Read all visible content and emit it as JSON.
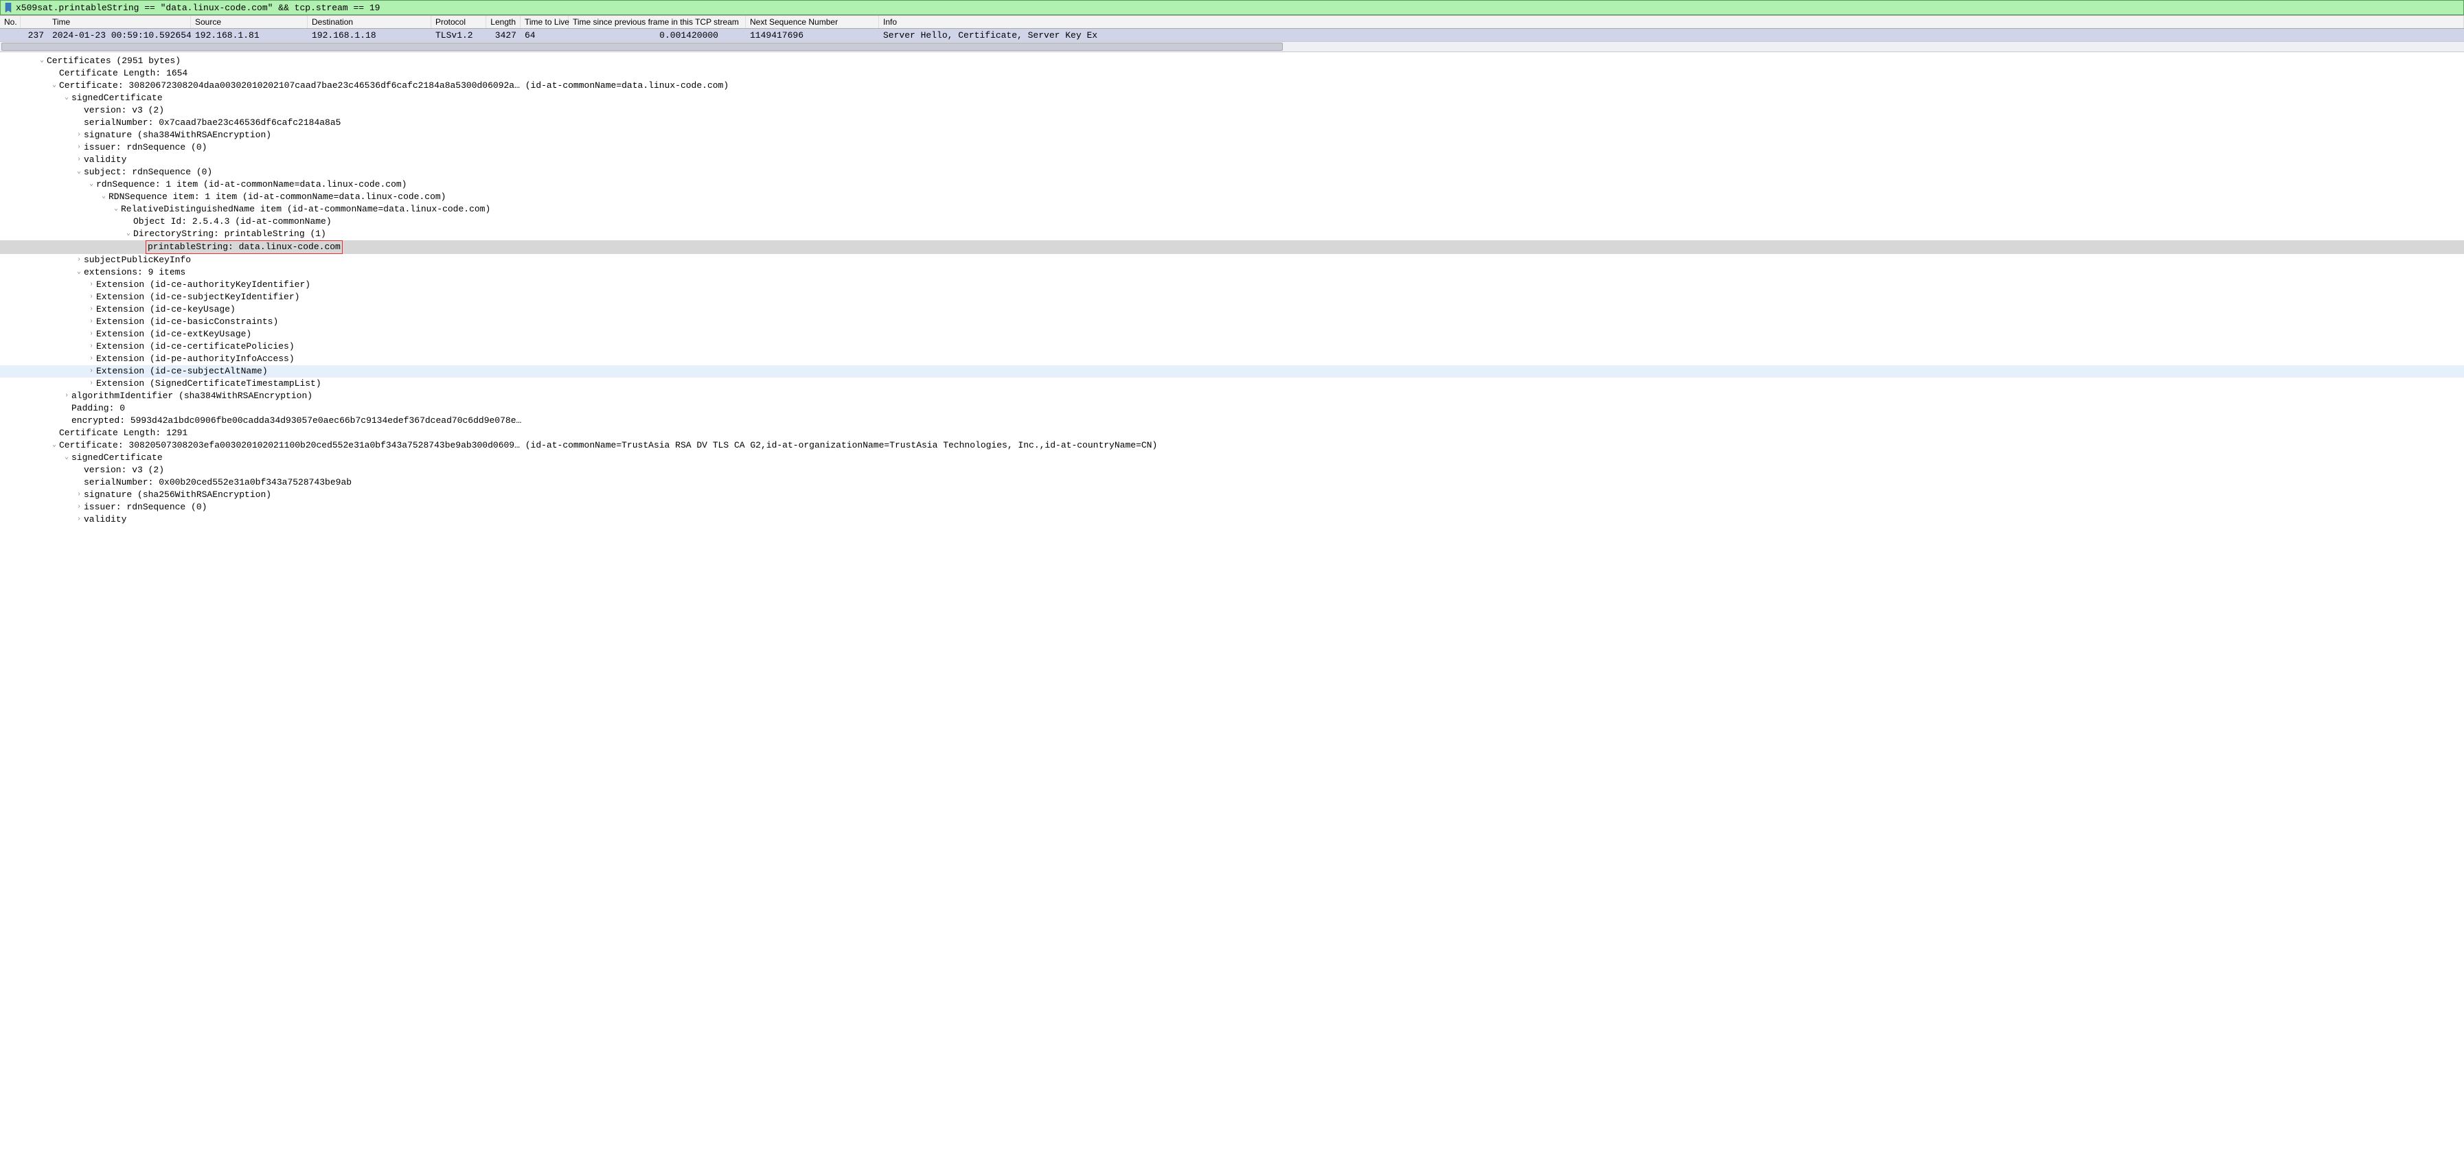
{
  "filter": {
    "text": "x509sat.printableString == \"data.linux-code.com\" && tcp.stream == 19"
  },
  "headers": {
    "no": "No.",
    "time": "Time",
    "source": "Source",
    "destination": "Destination",
    "protocol": "Protocol",
    "length": "Length",
    "ttl": "Time to Live",
    "delta": "Time since previous frame in this TCP stream",
    "nextseq": "Next Sequence Number",
    "info": "Info"
  },
  "row": {
    "num": "237",
    "time": "2024-01-23 00:59:10.592654",
    "src": "192.168.1.81",
    "dst": "192.168.1.18",
    "proto": "TLSv1.2",
    "len": "3427",
    "ttl": "64",
    "delta": "0.001420000",
    "nextseq": "1149417696",
    "info": "Server Hello, Certificate, Server Key Ex"
  },
  "t": {
    "certs": "Certificates (2951 bytes)",
    "certlen1": "Certificate Length: 1654",
    "cert1": "Certificate: 30820672308204daa00302010202107caad7bae23c46536df6cafc2184a8a5300d06092a… (id-at-commonName=data.linux-code.com)",
    "signed1": "signedCertificate",
    "version1": "version: v3 (2)",
    "serial1": "serialNumber: 0x7caad7bae23c46536df6cafc2184a8a5",
    "sig1": "signature (sha384WithRSAEncryption)",
    "issuer1": "issuer: rdnSequence (0)",
    "validity1": "validity",
    "subject1": "subject: rdnSequence (0)",
    "rdnseq": "rdnSequence: 1 item (id-at-commonName=data.linux-code.com)",
    "rdnitem": "RDNSequence item: 1 item (id-at-commonName=data.linux-code.com)",
    "rdname": "RelativeDistinguishedName item (id-at-commonName=data.linux-code.com)",
    "objid": "Object Id: 2.5.4.3 (id-at-commonName)",
    "dirstr": "DirectoryString: printableString (1)",
    "printable": "printableString: data.linux-code.com",
    "spki": "subjectPublicKeyInfo",
    "exts": "extensions: 9 items",
    "ext_akid": "Extension (id-ce-authorityKeyIdentifier)",
    "ext_skid": "Extension (id-ce-subjectKeyIdentifier)",
    "ext_ku": "Extension (id-ce-keyUsage)",
    "ext_bc": "Extension (id-ce-basicConstraints)",
    "ext_eku": "Extension (id-ce-extKeyUsage)",
    "ext_cp": "Extension (id-ce-certificatePolicies)",
    "ext_aia": "Extension (id-pe-authorityInfoAccess)",
    "ext_san": "Extension (id-ce-subjectAltName)",
    "ext_sct": "Extension (SignedCertificateTimestampList)",
    "algid": "algorithmIdentifier (sha384WithRSAEncryption)",
    "padding": "Padding: 0",
    "encrypted": "encrypted: 5993d42a1bdc0906fbe00cadda34d93057e0aec66b7c9134edef367dcead70c6dd9e078e…",
    "certlen2": "Certificate Length: 1291",
    "cert2": "Certificate: 30820507308203efa003020102021100b20ced552e31a0bf343a7528743be9ab300d0609… (id-at-commonName=TrustAsia RSA DV TLS CA G2,id-at-organizationName=TrustAsia Technologies, Inc.,id-at-countryName=CN)",
    "signed2": "signedCertificate",
    "version2": "version: v3 (2)",
    "serial2": "serialNumber: 0x00b20ced552e31a0bf343a7528743be9ab",
    "sig2": "signature (sha256WithRSAEncryption)",
    "issuer2": "issuer: rdnSequence (0)",
    "validity2": "validity"
  }
}
